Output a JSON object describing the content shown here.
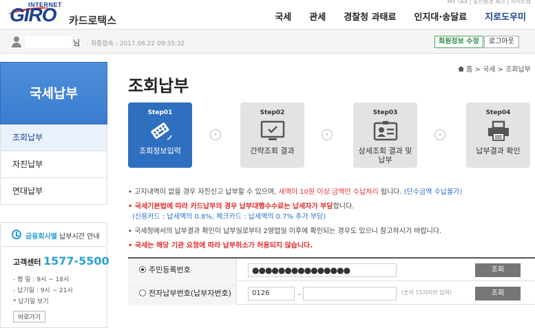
{
  "header": {
    "logo_top": "INTERNET",
    "logo_main": "GIRO",
    "logo_sub": "카드로택스",
    "top_mini": "MY TAX  |  통신환경 체크 | 사이트맵",
    "nav": [
      "국세",
      "관세",
      "경찰청 과태료",
      "인지대·송달료",
      "지로도우미"
    ]
  },
  "userbar": {
    "name_suffix": "님",
    "last_login": "· 최종접속 : 2017.06.22 09:35:32",
    "member_button": "회원정보 수정",
    "logout_button": "로그아웃"
  },
  "sidebar": {
    "title": "국세납부",
    "items": [
      "조회납부",
      "자진납부",
      "연대납부"
    ],
    "hours_highlight": "금융회사별",
    "hours_rest": " 납부시간 안내",
    "cs_label": "고객센터",
    "cs_number": "1577-5500",
    "cs_lines": [
      "- 평   일 : 9시 ~ 18시",
      "- 납기일 : 9시 ~ 21시",
      "* 납기일 보기"
    ],
    "cs_more": "바로가기"
  },
  "breadcrumb": "홈 > 국세 > 조회납부",
  "page_title": "조회납부",
  "steps": [
    {
      "num": "Step01",
      "label": "조회정보입력",
      "icon": "card-keyboard-icon"
    },
    {
      "num": "Step02",
      "label": "간략조회 결과",
      "icon": "monitor-check-icon"
    },
    {
      "num": "Step03",
      "label": "상세조회 결과 및 납부",
      "icon": "id-card-icon"
    },
    {
      "num": "Step04",
      "label": "납부결과 확인",
      "icon": "printer-icon"
    }
  ],
  "notes": {
    "n1_a": "고지내역이 없을 경우 자진신고 납부할 수 있으며, ",
    "n1_red": "세액이 10원 이상 금액만 수납처리",
    "n1_b": " 됩니다. ",
    "n1_blue": "(단수금액 수납불가)",
    "n2_red": "국세기본법에 따라 카드납부의 경우 납부대행수수료는 납세자가 부담",
    "n2_b": "합니다.",
    "n2_sub": "(신용카드 : 납세액의 0.8%, 체크카드 : 납세액의 0.7% 추가 부담)",
    "n3": "국세청에서의 납부결과 확인이 납부일로부터 2영업일 이후에 확인되는 경우도 있으니 참고하시기 바랍니다.",
    "n4_red": "국세는 해당 기관 요청에 따라 납부취소가 허용되지 않습니다."
  },
  "form": {
    "row1_label": "주민등록번호",
    "row1_value": "●●●●●●●●●●●●●●●",
    "row1_button": "조회",
    "row2_label": "전자납부번호(납부자번호)",
    "row2_prefix": "0126",
    "row2_dash": "-",
    "row2_hint": "(숫자 15자리만 입력)",
    "row2_button": "조회"
  },
  "colors": {
    "brand": "#1b3f93",
    "active_step": "#2f6fbf",
    "red": "#e32d2d",
    "accent_blue": "#2a9fd6"
  }
}
